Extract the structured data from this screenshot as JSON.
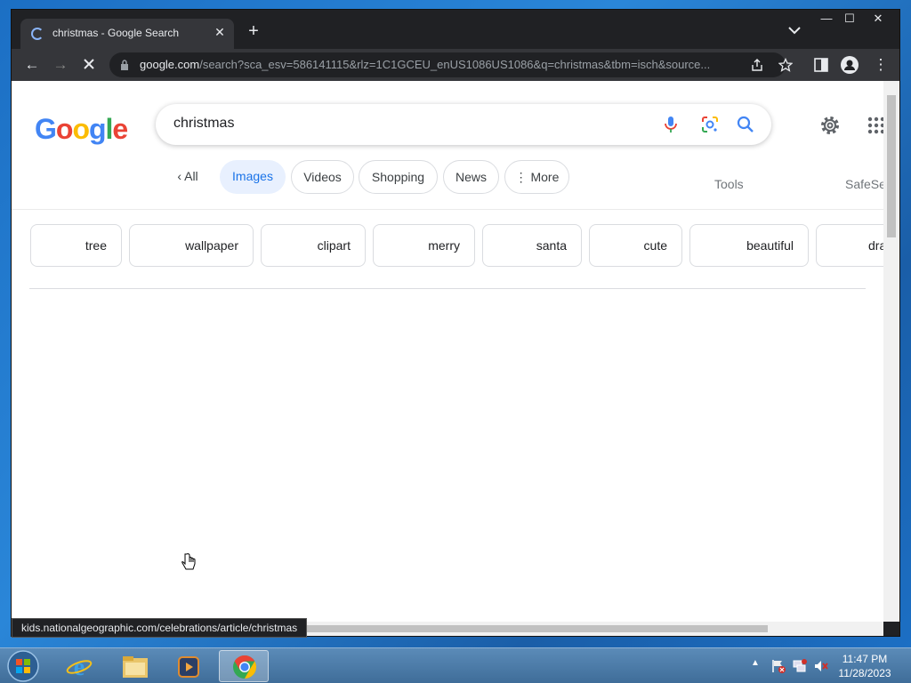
{
  "browser": {
    "tab_title": "christmas - Google Search",
    "tab_close": "✕",
    "new_tab": "+",
    "url_host": "google.com",
    "url_rest": "/search?sca_esv=586141115&rlz=1C1GCEU_enUS1086US1086&q=christmas&tbm=isch&source...",
    "status_url": "kids.nationalgeographic.com/celebrations/article/christmas"
  },
  "window_controls": {
    "minimize": "—",
    "maximize": "☐",
    "close": "✕"
  },
  "search": {
    "query": "christmas"
  },
  "nav": {
    "all": "All",
    "images": "Images",
    "videos": "Videos",
    "shopping": "Shopping",
    "news": "News",
    "more": "More",
    "tools": "Tools",
    "safesearch": "SafeSe"
  },
  "chips": [
    {
      "label": "tree"
    },
    {
      "label": "wallpaper"
    },
    {
      "label": "clipart"
    },
    {
      "label": "merry"
    },
    {
      "label": "santa"
    },
    {
      "label": "cute"
    },
    {
      "label": "beautiful"
    },
    {
      "label": "dra"
    }
  ],
  "logo": [
    "G",
    "o",
    "o",
    "g",
    "l",
    "e"
  ],
  "colors": {
    "google_blue": "#4285f4",
    "google_red": "#ea4335",
    "google_yellow": "#fbbc05",
    "google_green": "#34a853",
    "accent_selected": "#1a73e8"
  },
  "taskbar": {
    "time": "11:47 PM",
    "date": "11/28/2023"
  }
}
